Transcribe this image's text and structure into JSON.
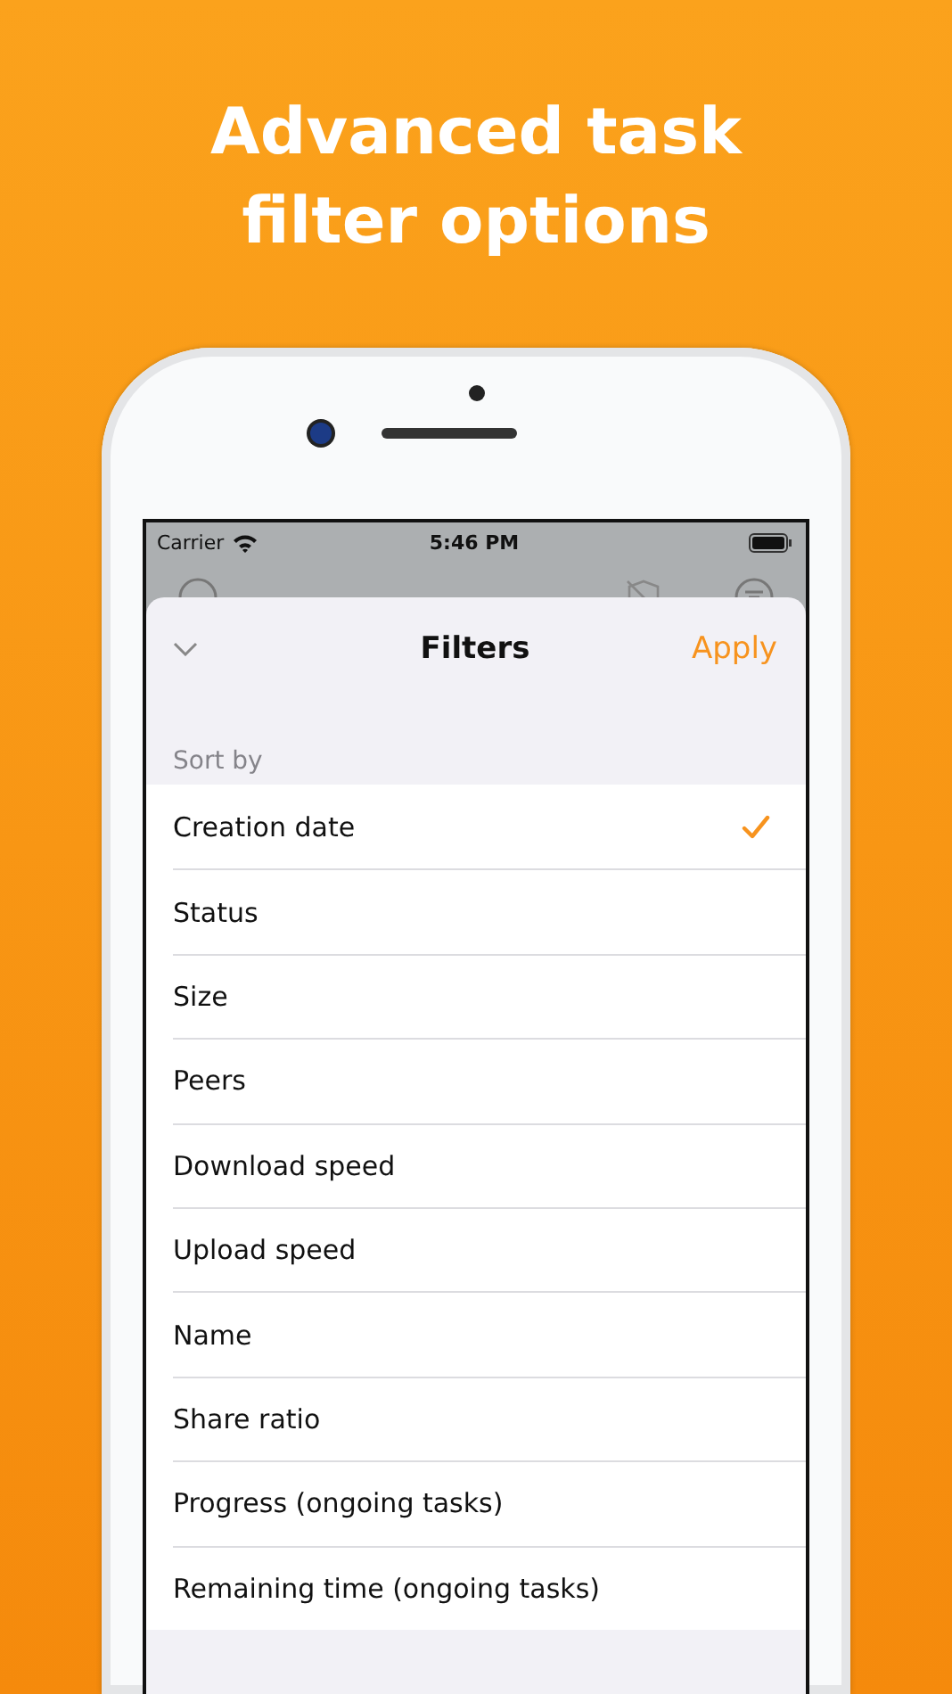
{
  "headline": "Advanced task filter options",
  "status_bar": {
    "carrier": "Carrier",
    "time": "5:46 PM"
  },
  "sheet": {
    "title": "Filters",
    "apply": "Apply"
  },
  "section": {
    "header": "Sort by"
  },
  "options": [
    {
      "label": "Creation date",
      "selected": true
    },
    {
      "label": "Status",
      "selected": false
    },
    {
      "label": "Size",
      "selected": false
    },
    {
      "label": "Peers",
      "selected": false
    },
    {
      "label": "Download speed",
      "selected": false
    },
    {
      "label": "Upload speed",
      "selected": false
    },
    {
      "label": "Name",
      "selected": false
    },
    {
      "label": "Share ratio",
      "selected": false
    },
    {
      "label": "Progress (ongoing tasks)",
      "selected": false
    },
    {
      "label": "Remaining time (ongoing tasks)",
      "selected": false
    }
  ]
}
